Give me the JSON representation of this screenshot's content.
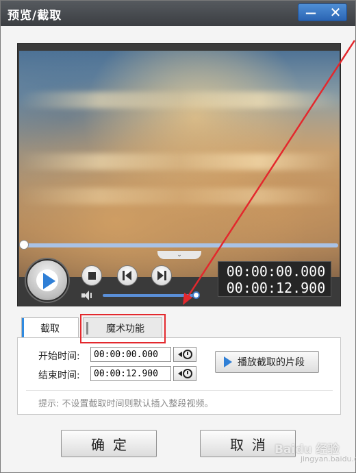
{
  "window": {
    "title": "预览/截取",
    "min_symbol": "—",
    "close_symbol": "✕"
  },
  "player": {
    "current_time": "00:00:00.000",
    "total_time": "00:00:12.900",
    "seek_progress": 0.0,
    "volume_level": 0.95
  },
  "tabs": [
    {
      "label": "截取",
      "active": true
    },
    {
      "label": "魔术功能",
      "active": false
    }
  ],
  "trim": {
    "start_label": "开始时间:",
    "start_value": "00:00:00.000",
    "end_label": "结束时间:",
    "end_value": "00:00:12.900",
    "play_segment_label": "播放截取的片段",
    "hint": "提示: 不设置截取时间则默认插入整段视频。"
  },
  "footer": {
    "ok_label": "确定",
    "cancel_label": "取消"
  },
  "watermark": {
    "brand": "Baidu 经验",
    "sub": "jingyan.baidu.com"
  },
  "colors": {
    "annotation": "#e3282d",
    "accent": "#2f7fd6",
    "titlebar": "#3b3e42"
  }
}
